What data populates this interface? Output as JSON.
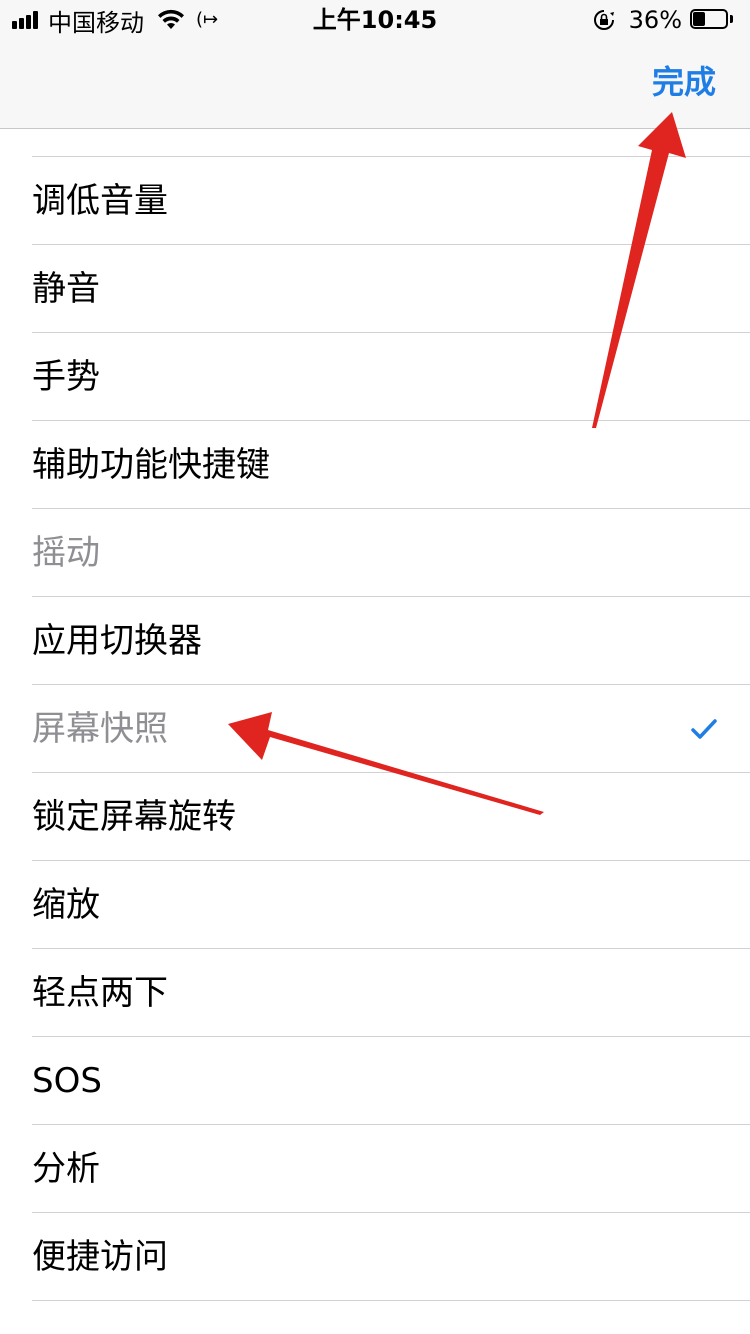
{
  "status_bar": {
    "carrier": "中国移动",
    "time": "上午10:45",
    "battery_percent": "36%",
    "battery_level": 0.36
  },
  "nav": {
    "done_label": "完成",
    "accent_color": "#1f7ee6"
  },
  "list": {
    "items": [
      {
        "label": "调低音量",
        "disabled": false,
        "checked": false
      },
      {
        "label": "静音",
        "disabled": false,
        "checked": false
      },
      {
        "label": "手势",
        "disabled": false,
        "checked": false
      },
      {
        "label": "辅助功能快捷键",
        "disabled": false,
        "checked": false
      },
      {
        "label": "摇动",
        "disabled": true,
        "checked": false
      },
      {
        "label": "应用切换器",
        "disabled": false,
        "checked": false
      },
      {
        "label": "屏幕快照",
        "disabled": true,
        "checked": true
      },
      {
        "label": "锁定屏幕旋转",
        "disabled": false,
        "checked": false
      },
      {
        "label": "缩放",
        "disabled": false,
        "checked": false
      },
      {
        "label": "轻点两下",
        "disabled": false,
        "checked": false
      },
      {
        "label": "SOS",
        "disabled": false,
        "checked": false
      },
      {
        "label": "分析",
        "disabled": false,
        "checked": false
      },
      {
        "label": "便捷访问",
        "disabled": false,
        "checked": false
      }
    ]
  },
  "annotations": {
    "arrow_color": "#e0241f"
  }
}
